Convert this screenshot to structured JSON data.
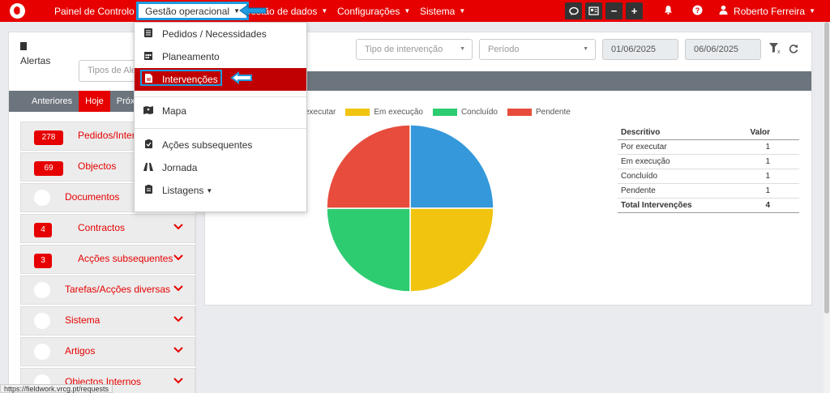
{
  "navbar": {
    "items": [
      {
        "label": "Painel de Controlo"
      },
      {
        "label": "Gestão operacional"
      },
      {
        "label": "Gestão de dados"
      },
      {
        "label": "Configurações"
      },
      {
        "label": "Sistema"
      }
    ],
    "user": "Roberto Ferreira",
    "accent": "#e60000"
  },
  "dropdown": {
    "items": [
      {
        "label": "Pedidos / Necessidades",
        "icon": "list-icon"
      },
      {
        "label": "Planeamento",
        "icon": "calendar-icon"
      },
      {
        "label": "Intervenções",
        "icon": "file-icon"
      },
      {
        "label": "Mapa",
        "icon": "map-icon"
      },
      {
        "label": "Ações subsequentes",
        "icon": "clipboard-check-icon"
      },
      {
        "label": "Jornada",
        "icon": "road-icon"
      },
      {
        "label": "Listagens",
        "icon": "clipboard-icon"
      }
    ]
  },
  "left": {
    "title": "Alertas",
    "search_placeholder": "Tipos de Alertas",
    "tabs": [
      {
        "label": "Anteriores"
      },
      {
        "label": "Hoje"
      },
      {
        "label": "Próximos"
      }
    ],
    "items": [
      {
        "count": "278",
        "label": "Pedidos/Intervenções"
      },
      {
        "count": "69",
        "label": "Objectos"
      },
      {
        "count": "",
        "label": "Documentos"
      },
      {
        "count": "4",
        "label": "Contractos"
      },
      {
        "count": "3",
        "label": "Acções subsequentes"
      },
      {
        "count": "",
        "label": "Tarefas/Acções diversas"
      },
      {
        "count": "",
        "label": "Sistema"
      },
      {
        "count": "",
        "label": "Artigos"
      },
      {
        "count": "",
        "label": "Objectos Internos"
      }
    ]
  },
  "filters": {
    "tipo_placeholder": "Tipo de intervenção",
    "periodo_placeholder": "Período",
    "date_from": "01/06/2025",
    "date_to": "06/06/2025"
  },
  "chart_data": {
    "type": "pie",
    "categories": [
      "Por executar",
      "Em execução",
      "Concluído",
      "Pendente"
    ],
    "values": [
      1,
      1,
      1,
      1
    ],
    "colors": [
      "#3498db",
      "#f1c40f",
      "#2ecc71",
      "#e74c3c"
    ],
    "legend_position": "top",
    "legend_labels": [
      "executar",
      "Em execução",
      "Concluído",
      "Pendente"
    ]
  },
  "table": {
    "headers": [
      "Descritivo",
      "Valor"
    ],
    "rows": [
      {
        "label": "Por executar",
        "value": "1"
      },
      {
        "label": "Em execução",
        "value": "1"
      },
      {
        "label": "Concluído",
        "value": "1"
      },
      {
        "label": "Pendente",
        "value": "1"
      }
    ],
    "total": {
      "label": "Total Intervenções",
      "value": "4"
    }
  },
  "status_url": "https://fieldwork.vrcg.pt/requests"
}
